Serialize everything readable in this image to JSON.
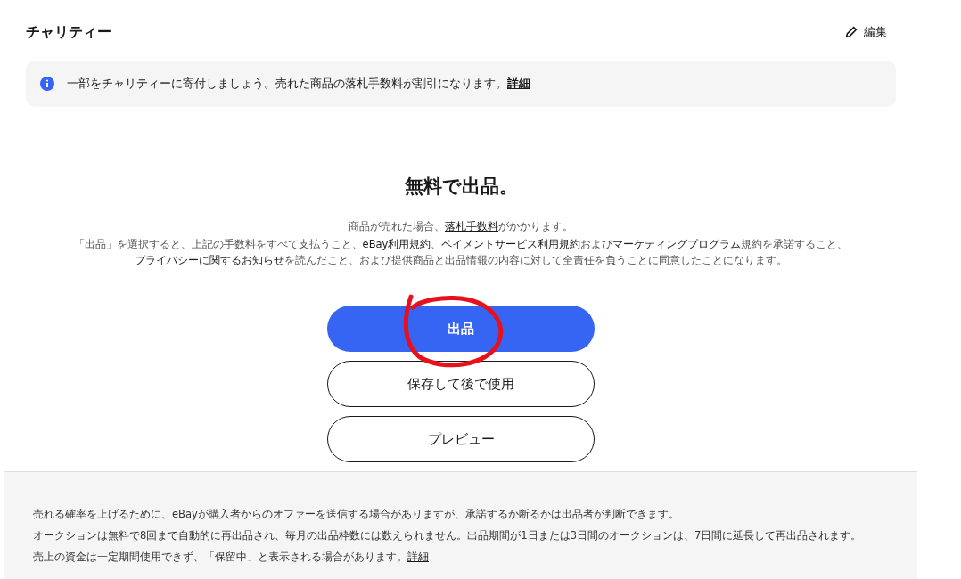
{
  "charity": {
    "title": "チャリティー",
    "edit_label": "編集",
    "notice": {
      "text": "一部をチャリティーに寄付しましょう。売れた商品の落札手数料が割引になります。",
      "link": "詳細"
    }
  },
  "listing": {
    "heading": "無料で出品。",
    "fee_line": [
      {
        "text": "商品が売れた場合、",
        "link": false
      },
      {
        "text": "落札手数料",
        "link": true
      },
      {
        "text": "がかかります。",
        "link": false
      }
    ],
    "terms": [
      {
        "text": "「出品」を選択すると、上記の手数料をすべて支払うこと、",
        "link": false
      },
      {
        "text": "eBay利用規約",
        "link": true
      },
      {
        "text": "、",
        "link": false
      },
      {
        "text": "ペイメントサービス利用規約",
        "link": true
      },
      {
        "text": "および",
        "link": false
      },
      {
        "text": "マーケティングプログラム",
        "link": true
      },
      {
        "text": "規約を承諾すること、",
        "link": false
      },
      {
        "text": "プライバシーに関するお知らせ",
        "link": true
      },
      {
        "text": "を読んだこと、および提供商品と出品情報の内容に対して全責任を負うことに同意したことになります。",
        "link": false
      }
    ],
    "buttons": [
      {
        "label": "出品",
        "kind": "primary",
        "annotated": true
      },
      {
        "label": "保存して後で使用",
        "kind": "secondary",
        "annotated": false
      },
      {
        "label": "プレビュー",
        "kind": "secondary",
        "annotated": false
      }
    ]
  },
  "footer": {
    "lines": [
      {
        "text": "売れる確率を上げるために、eBayが購入者からのオファーを送信する場合がありますが、承諾するか断るかは出品者が判断できます。"
      },
      {
        "text": "オークションは無料で8回まで自動的に再出品され、毎月の出品枠数には数えられません。出品期間が1日または3日間のオークションは、7日間に延長して再出品されます。"
      },
      {
        "text": "売上の資金は一定期間使用できず、「保留中」と表示される場合があります。",
        "link": "詳細"
      }
    ]
  }
}
